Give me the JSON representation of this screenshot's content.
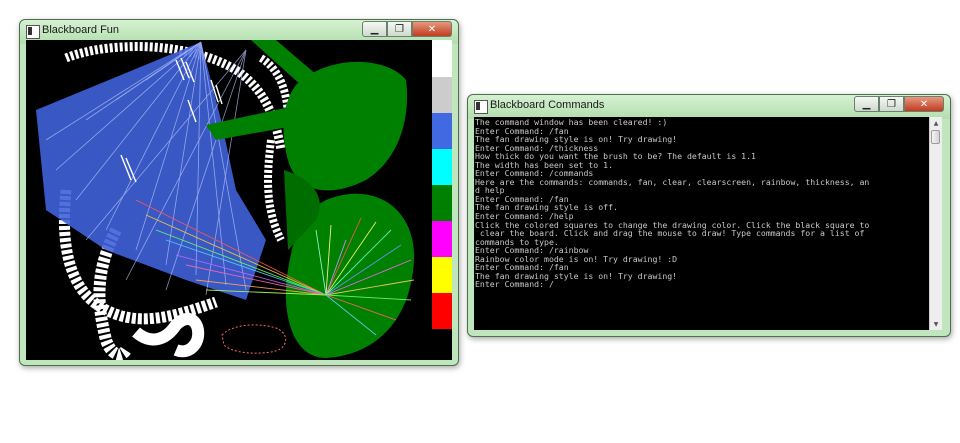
{
  "blackboard_window": {
    "title": "Blackboard Fun",
    "palette": [
      {
        "name": "white",
        "color": "#ffffff"
      },
      {
        "name": "light-gray",
        "color": "#cccccc"
      },
      {
        "name": "blue",
        "color": "#4169e1"
      },
      {
        "name": "cyan",
        "color": "#00ffff"
      },
      {
        "name": "green",
        "color": "#008000"
      },
      {
        "name": "magenta",
        "color": "#ff00ff"
      },
      {
        "name": "yellow",
        "color": "#ffff00"
      },
      {
        "name": "red",
        "color": "#ff0000"
      }
    ],
    "canvas_background": "#000000"
  },
  "commands_window": {
    "title": "Blackboard Commands",
    "lines": [
      "The command window has been cleared! :)",
      "Enter Command: /fan",
      "The fan drawing style is on! Try drawing!",
      "Enter Command: /thickness",
      "How thick do you want the brush to be? The default is 1.1",
      "The width has been set to 1.",
      "Enter Command: /commands",
      "Here are the commands: commands, fan, clear, clearscreen, rainbow, thickness, an",
      "d help",
      "Enter Command: /fan",
      "The fan drawing style is off.",
      "Enter Command: /help",
      "Click the colored squares to change the drawing color. Click the black square to",
      " clear the board. Click and drag the mouse to draw! Type commands for a list of",
      "commands to type.",
      "Enter Command: /rainbow",
      "Rainbow color mode is on! Try drawing! :D",
      "Enter Command: /fan",
      "The fan drawing style is on! Try drawing!",
      "Enter Command: /"
    ]
  },
  "icons": {
    "minimize": "minimize-icon",
    "maximize": "maximize-icon",
    "close": "close-icon",
    "app": "console-app-icon"
  }
}
